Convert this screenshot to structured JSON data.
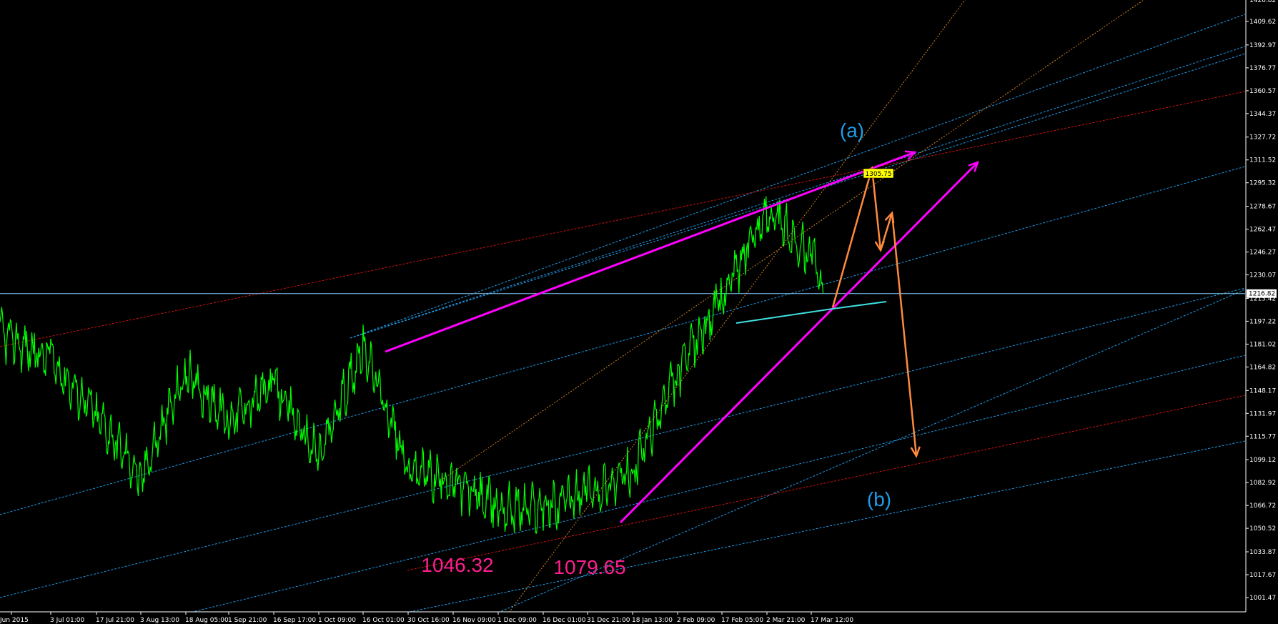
{
  "chart_data": {
    "type": "line",
    "instrument_series": {
      "color": "#00ff00",
      "x_dates": [
        "2015-06-19",
        "2015-07-03",
        "2015-07-17",
        "2015-08-03",
        "2015-08-18",
        "2015-09-01",
        "2015-09-16",
        "2015-10-01",
        "2015-10-16",
        "2015-10-30",
        "2015-11-16",
        "2015-12-01",
        "2015-12-16",
        "2015-12-31",
        "2016-01-18",
        "2016-02-02",
        "2016-02-17",
        "2016-03-02",
        "2016-03-17",
        "2016-03-21"
      ],
      "anchor_values": [
        1188,
        1170,
        1131,
        1087,
        1160,
        1128,
        1152,
        1100,
        1180,
        1093,
        1083,
        1065,
        1065,
        1075,
        1090,
        1160,
        1215,
        1275,
        1245,
        1216.82
      ]
    },
    "y_axis": {
      "min": 1001.47,
      "max": 1432,
      "tick_labels": [
        "1409.62",
        "1392.97",
        "1376.77",
        "1360.57",
        "1344.37",
        "1327.72",
        "1311.52",
        "1295.32",
        "1278.67",
        "1262.47",
        "1246.27",
        "1230.07",
        "1213.42",
        "1197.22",
        "1181.02",
        "1164.82",
        "1148.17",
        "1131.97",
        "1115.77",
        "1099.12",
        "1082.92",
        "1066.72",
        "1050.52",
        "1033.87",
        "1017.67",
        "1001.47"
      ],
      "tick_values": [
        1409.62,
        1392.97,
        1376.77,
        1360.57,
        1344.37,
        1327.72,
        1311.52,
        1295.32,
        1278.67,
        1262.47,
        1246.27,
        1230.07,
        1213.42,
        1197.22,
        1181.02,
        1164.82,
        1148.17,
        1131.97,
        1115.77,
        1099.12,
        1082.92,
        1066.72,
        1050.52,
        1033.87,
        1017.67,
        1001.47
      ],
      "top_partial_label": "1426.82"
    },
    "x_axis": {
      "tick_labels": [
        "Jun 2015",
        "3 Jul 01:00",
        "17 Jul 21:00",
        "3 Aug 13:00",
        "18 Aug 05:00",
        "1 Sep 21:00",
        "16 Sep 17:00",
        "1 Oct 09:00",
        "16 Oct 01:00",
        "30 Oct 16:00",
        "16 Nov 09:00",
        "1 Dec 09:00",
        "16 Dec 01:00",
        "31 Dec 21:00",
        "18 Jan 13:00",
        "2 Feb 09:00",
        "17 Feb 05:00",
        "2 Mar 21:00",
        "17 Mar 12:00"
      ]
    },
    "current_price": {
      "value": 1216.82,
      "label": "1216.82",
      "line_color": "#87cefa"
    },
    "target_price": {
      "value": 1305.75,
      "label": "1305.75",
      "bg_color": "#ffff00",
      "text_color": "#000000"
    },
    "annotations": [
      {
        "text": "(a)",
        "color": "#1e9be8",
        "value": 1337
      },
      {
        "text": "(b)",
        "color": "#1e9be8",
        "value": 1081
      },
      {
        "text": "1046.32",
        "color": "#ff1f8f",
        "value": 1046.32
      },
      {
        "text": "1079.65",
        "color": "#ff1f8f",
        "value": 1079.65
      }
    ],
    "colors": {
      "background": "#000000",
      "trend_magenta": "#ff00ff",
      "projection_orange": "#ff8a3d",
      "channel_blue": "#1e9be8",
      "channel_red": "#d01010",
      "fib_orange": "#d08020",
      "support_cyan": "#40e0e0"
    }
  }
}
